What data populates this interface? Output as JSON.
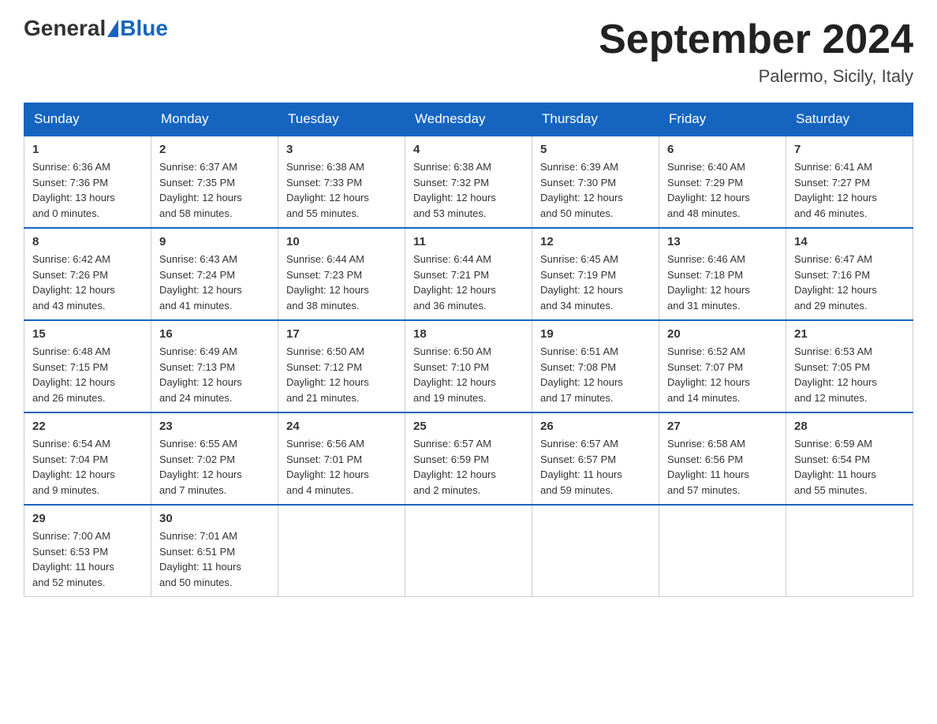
{
  "header": {
    "logo_general": "General",
    "logo_blue": "Blue",
    "month_title": "September 2024",
    "location": "Palermo, Sicily, Italy"
  },
  "days_of_week": [
    "Sunday",
    "Monday",
    "Tuesday",
    "Wednesday",
    "Thursday",
    "Friday",
    "Saturday"
  ],
  "weeks": [
    [
      {
        "date": "1",
        "sunrise": "6:36 AM",
        "sunset": "7:36 PM",
        "daylight": "13 hours and 0 minutes."
      },
      {
        "date": "2",
        "sunrise": "6:37 AM",
        "sunset": "7:35 PM",
        "daylight": "12 hours and 58 minutes."
      },
      {
        "date": "3",
        "sunrise": "6:38 AM",
        "sunset": "7:33 PM",
        "daylight": "12 hours and 55 minutes."
      },
      {
        "date": "4",
        "sunrise": "6:38 AM",
        "sunset": "7:32 PM",
        "daylight": "12 hours and 53 minutes."
      },
      {
        "date": "5",
        "sunrise": "6:39 AM",
        "sunset": "7:30 PM",
        "daylight": "12 hours and 50 minutes."
      },
      {
        "date": "6",
        "sunrise": "6:40 AM",
        "sunset": "7:29 PM",
        "daylight": "12 hours and 48 minutes."
      },
      {
        "date": "7",
        "sunrise": "6:41 AM",
        "sunset": "7:27 PM",
        "daylight": "12 hours and 46 minutes."
      }
    ],
    [
      {
        "date": "8",
        "sunrise": "6:42 AM",
        "sunset": "7:26 PM",
        "daylight": "12 hours and 43 minutes."
      },
      {
        "date": "9",
        "sunrise": "6:43 AM",
        "sunset": "7:24 PM",
        "daylight": "12 hours and 41 minutes."
      },
      {
        "date": "10",
        "sunrise": "6:44 AM",
        "sunset": "7:23 PM",
        "daylight": "12 hours and 38 minutes."
      },
      {
        "date": "11",
        "sunrise": "6:44 AM",
        "sunset": "7:21 PM",
        "daylight": "12 hours and 36 minutes."
      },
      {
        "date": "12",
        "sunrise": "6:45 AM",
        "sunset": "7:19 PM",
        "daylight": "12 hours and 34 minutes."
      },
      {
        "date": "13",
        "sunrise": "6:46 AM",
        "sunset": "7:18 PM",
        "daylight": "12 hours and 31 minutes."
      },
      {
        "date": "14",
        "sunrise": "6:47 AM",
        "sunset": "7:16 PM",
        "daylight": "12 hours and 29 minutes."
      }
    ],
    [
      {
        "date": "15",
        "sunrise": "6:48 AM",
        "sunset": "7:15 PM",
        "daylight": "12 hours and 26 minutes."
      },
      {
        "date": "16",
        "sunrise": "6:49 AM",
        "sunset": "7:13 PM",
        "daylight": "12 hours and 24 minutes."
      },
      {
        "date": "17",
        "sunrise": "6:50 AM",
        "sunset": "7:12 PM",
        "daylight": "12 hours and 21 minutes."
      },
      {
        "date": "18",
        "sunrise": "6:50 AM",
        "sunset": "7:10 PM",
        "daylight": "12 hours and 19 minutes."
      },
      {
        "date": "19",
        "sunrise": "6:51 AM",
        "sunset": "7:08 PM",
        "daylight": "12 hours and 17 minutes."
      },
      {
        "date": "20",
        "sunrise": "6:52 AM",
        "sunset": "7:07 PM",
        "daylight": "12 hours and 14 minutes."
      },
      {
        "date": "21",
        "sunrise": "6:53 AM",
        "sunset": "7:05 PM",
        "daylight": "12 hours and 12 minutes."
      }
    ],
    [
      {
        "date": "22",
        "sunrise": "6:54 AM",
        "sunset": "7:04 PM",
        "daylight": "12 hours and 9 minutes."
      },
      {
        "date": "23",
        "sunrise": "6:55 AM",
        "sunset": "7:02 PM",
        "daylight": "12 hours and 7 minutes."
      },
      {
        "date": "24",
        "sunrise": "6:56 AM",
        "sunset": "7:01 PM",
        "daylight": "12 hours and 4 minutes."
      },
      {
        "date": "25",
        "sunrise": "6:57 AM",
        "sunset": "6:59 PM",
        "daylight": "12 hours and 2 minutes."
      },
      {
        "date": "26",
        "sunrise": "6:57 AM",
        "sunset": "6:57 PM",
        "daylight": "11 hours and 59 minutes."
      },
      {
        "date": "27",
        "sunrise": "6:58 AM",
        "sunset": "6:56 PM",
        "daylight": "11 hours and 57 minutes."
      },
      {
        "date": "28",
        "sunrise": "6:59 AM",
        "sunset": "6:54 PM",
        "daylight": "11 hours and 55 minutes."
      }
    ],
    [
      {
        "date": "29",
        "sunrise": "7:00 AM",
        "sunset": "6:53 PM",
        "daylight": "11 hours and 52 minutes."
      },
      {
        "date": "30",
        "sunrise": "7:01 AM",
        "sunset": "6:51 PM",
        "daylight": "11 hours and 50 minutes."
      },
      null,
      null,
      null,
      null,
      null
    ]
  ]
}
